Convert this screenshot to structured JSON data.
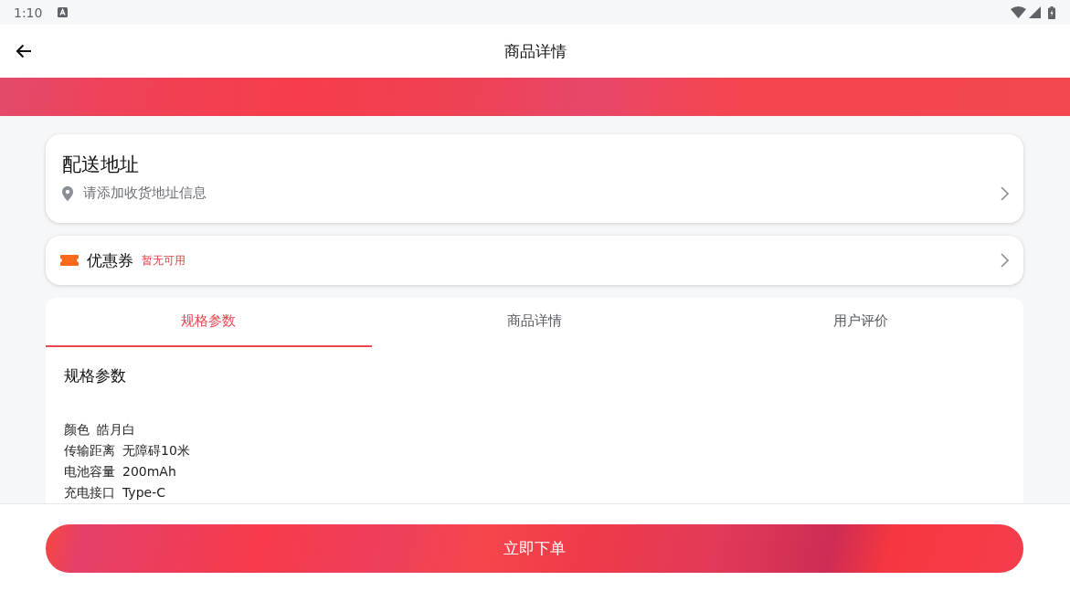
{
  "status_bar": {
    "time": "1:10"
  },
  "app_bar": {
    "title": "商品详情"
  },
  "address_card": {
    "title": "配送地址",
    "hint": "请添加收货地址信息"
  },
  "coupon_card": {
    "label": "优惠券",
    "status": "暂无可用"
  },
  "tabs": [
    {
      "label": "规格参数",
      "selected": true
    },
    {
      "label": "商品详情",
      "selected": false
    },
    {
      "label": "用户评价",
      "selected": false
    }
  ],
  "spec_section": {
    "title": "规格参数",
    "specs": [
      {
        "name": "颜色",
        "value": "皓月白"
      },
      {
        "name": "传输距离",
        "value": "无障碍10米"
      },
      {
        "name": "电池容量",
        "value": "200mAh"
      },
      {
        "name": "充电接口",
        "value": "Type-C"
      }
    ]
  },
  "order_button": {
    "label": "立即下单"
  }
}
